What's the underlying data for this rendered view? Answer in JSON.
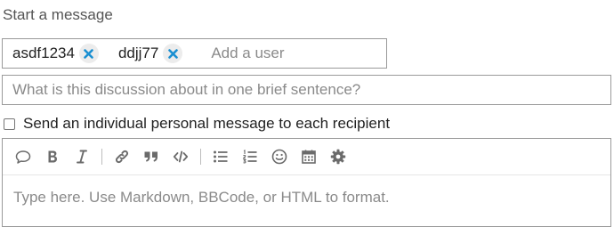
{
  "title": "Start a message",
  "users": [
    {
      "name": "asdf1234"
    },
    {
      "name": "ddjj77"
    }
  ],
  "add_user_placeholder": "Add a user",
  "subject_placeholder": "What is this discussion about in one brief sentence?",
  "individual_message": {
    "label": "Send an individual personal message to each recipient",
    "checked": false
  },
  "toolbar": {
    "items": [
      "quote-icon",
      "bold-icon",
      "italic-icon",
      "link-icon",
      "blockquote-icon",
      "code-icon",
      "bullet-list-icon",
      "numbered-list-icon",
      "emoji-icon",
      "calendar-icon",
      "gear-icon"
    ]
  },
  "editor_placeholder": "Type here. Use Markdown, BBCode, or HTML to format.",
  "colors": {
    "remove_icon": "#1a8fd1",
    "icon": "#6b6b6b",
    "border": "#9a9a9a",
    "placeholder": "#8a8a8a"
  }
}
